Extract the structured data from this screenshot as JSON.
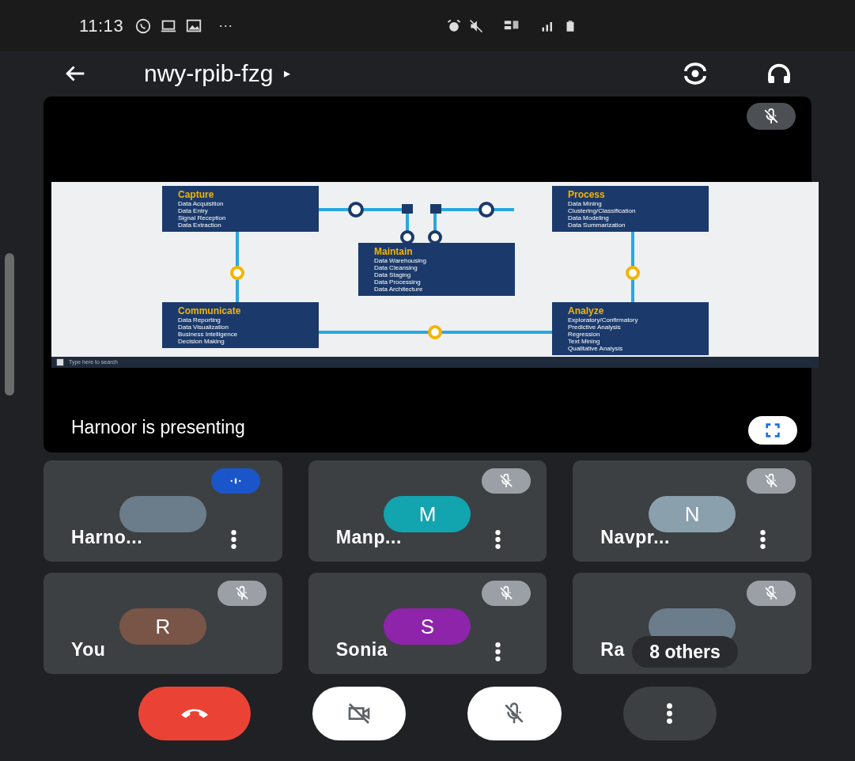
{
  "status_bar": {
    "time": "11:13",
    "overflow": "···"
  },
  "header": {
    "title": "nwy-rpib-fzg",
    "caret": "▸"
  },
  "presentation": {
    "presenter_label": "Harnoor is presenting",
    "muted": true,
    "slide": {
      "boxes": [
        {
          "title": "Capture",
          "items": [
            "Data Acquisition",
            "Data Entry",
            "Signal Reception",
            "Data Extraction"
          ]
        },
        {
          "title": "Maintain",
          "items": [
            "Data Warehousing",
            "Data Cleansing",
            "Data Staging",
            "Data Processing",
            "Data Architecture"
          ]
        },
        {
          "title": "Process",
          "items": [
            "Data Mining",
            "Clustering/Classification",
            "Data Modeling",
            "Data Summarization"
          ]
        },
        {
          "title": "Communicate",
          "items": [
            "Data Reporting",
            "Data Visualization",
            "Business Intelligence",
            "Decision Making"
          ]
        },
        {
          "title": "Analyze",
          "items": [
            "Exploratory/Confirmatory",
            "Predictive Analysis",
            "Regression",
            "Text Mining",
            "Qualitative Analysis"
          ]
        }
      ],
      "taskbar_search": "Type here to search"
    }
  },
  "participants": [
    {
      "name": "Harno...",
      "kind": "photo",
      "speaking": true,
      "muted": false,
      "menu": true
    },
    {
      "name": "Manp...",
      "kind": "initial",
      "initial": "M",
      "color": "#12a4af",
      "speaking": false,
      "muted": true,
      "menu": true
    },
    {
      "name": "Navpr...",
      "kind": "initial",
      "initial": "N",
      "color": "#8aa0ad",
      "speaking": false,
      "muted": true,
      "menu": true
    },
    {
      "name": "You",
      "kind": "initial",
      "initial": "R",
      "color": "#795548",
      "speaking": false,
      "muted": true,
      "menu": false
    },
    {
      "name": "Sonia",
      "kind": "initial",
      "initial": "S",
      "color": "#8e24aa",
      "speaking": false,
      "muted": true,
      "menu": true
    },
    {
      "name": "Ra",
      "kind": "photo",
      "speaking": false,
      "muted": true,
      "menu": false,
      "overlay": "8 others"
    }
  ],
  "controls": [
    {
      "kind": "end-call"
    },
    {
      "kind": "camera-off"
    },
    {
      "kind": "mic-off"
    },
    {
      "kind": "more"
    }
  ]
}
